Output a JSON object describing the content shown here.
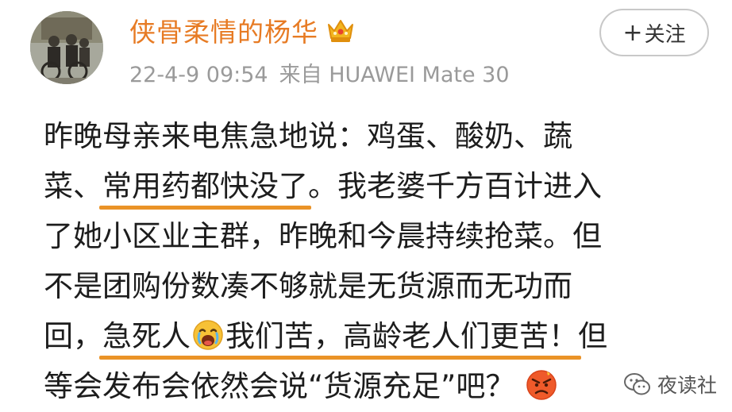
{
  "header": {
    "username": "侠骨柔情的杨华",
    "timestamp": "22-4-9 09:54",
    "source_prefix": "来自",
    "source_device": "HUAWEI Mate 30",
    "follow_label": "关注",
    "follow_icon": "plus-icon",
    "badge_icon": "crown-icon"
  },
  "post": {
    "line1": "昨晚母亲来电焦急地说：鸡蛋、酸奶、蔬",
    "line2_a": "菜、",
    "line2_b": "常用药都快没了",
    "line2_c": "。我老婆千方百计进入",
    "line3": "了她小区业主群，昨晚和今晨持续抢菜。但",
    "line4": "不是团购份数凑不够就是无货源而无功而",
    "line5_a": "回，",
    "line5_b1": "急死人",
    "line5_b2": "我们苦，高龄老人们更苦！",
    "line5_c": "但",
    "line6": "等会发布会依然会说“货源充足”吧？",
    "emoji_1": "crying-face-emoji",
    "emoji_2": "angry-face-emoji"
  },
  "watermark": {
    "text": "夜读社",
    "icon": "wechat-official-account-icon"
  },
  "colors": {
    "username": "#e77b24",
    "highlight_underline": "#ea9327",
    "meta_text": "#9a9a9a",
    "body_text": "#1d1d1d"
  }
}
